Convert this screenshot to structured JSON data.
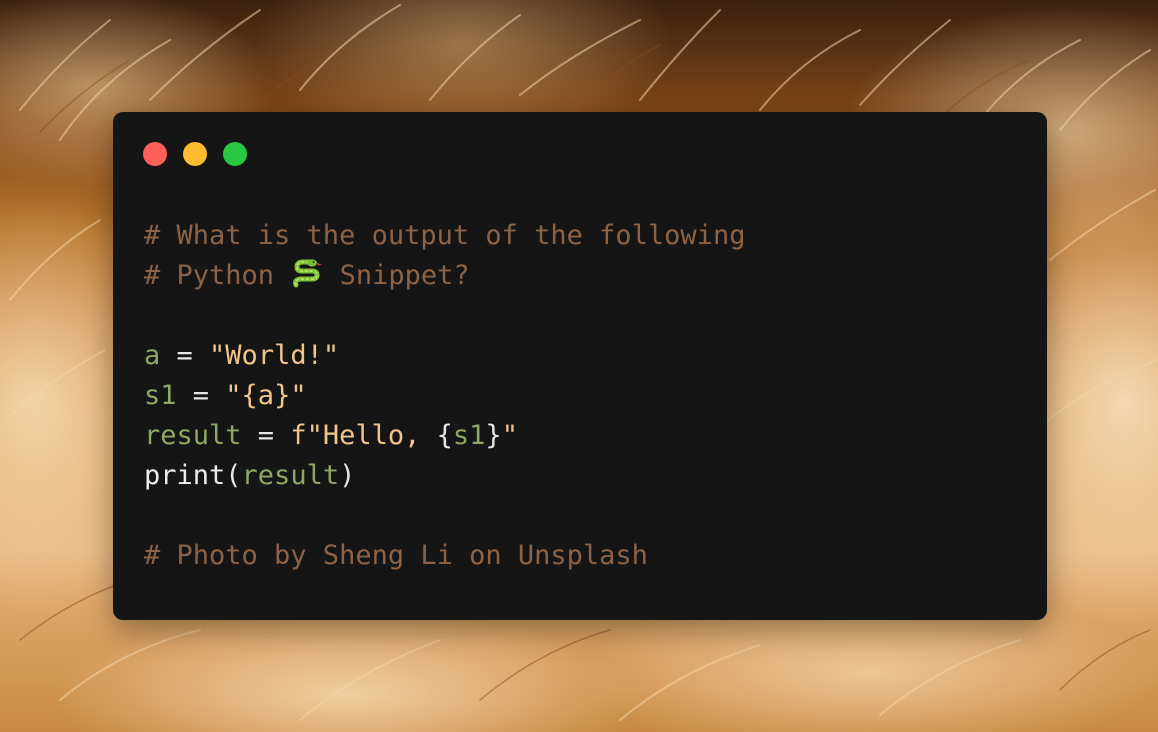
{
  "window": {
    "controls": [
      "close",
      "minimize",
      "maximize"
    ]
  },
  "code": {
    "lines": [
      [
        {
          "t": "# What is the output of the following",
          "k": "comment"
        }
      ],
      [
        {
          "t": "# Python ",
          "k": "comment"
        },
        {
          "icon": "snake-icon"
        },
        {
          "t": " Snippet?",
          "k": "comment"
        }
      ],
      [],
      [
        {
          "t": "a",
          "k": "var"
        },
        {
          "t": " = ",
          "k": "op"
        },
        {
          "t": "\"World!\"",
          "k": "str"
        }
      ],
      [
        {
          "t": "s1",
          "k": "var"
        },
        {
          "t": " = ",
          "k": "op"
        },
        {
          "t": "\"{a}\"",
          "k": "str"
        }
      ],
      [
        {
          "t": "result",
          "k": "var"
        },
        {
          "t": " = ",
          "k": "op"
        },
        {
          "t": "f\"Hello, ",
          "k": "str"
        },
        {
          "t": "{",
          "k": "op"
        },
        {
          "t": "s1",
          "k": "var"
        },
        {
          "t": "}",
          "k": "op"
        },
        {
          "t": "\"",
          "k": "str"
        }
      ],
      [
        {
          "t": "print",
          "k": "fn"
        },
        {
          "t": "(",
          "k": "op"
        },
        {
          "t": "result",
          "k": "var"
        },
        {
          "t": ")",
          "k": "op"
        }
      ],
      [],
      [
        {
          "t": "# Photo by Sheng Li on Unsplash",
          "k": "comment"
        }
      ]
    ]
  },
  "colors": {
    "window_bg": "#151515",
    "comment": "#8c6346",
    "var": "#8ea764",
    "op": "#e6e6e6",
    "str": "#f0c68a",
    "fn": "#ededed",
    "close": "#fe5f57",
    "minimize": "#febc2e",
    "maximize": "#28c840"
  }
}
